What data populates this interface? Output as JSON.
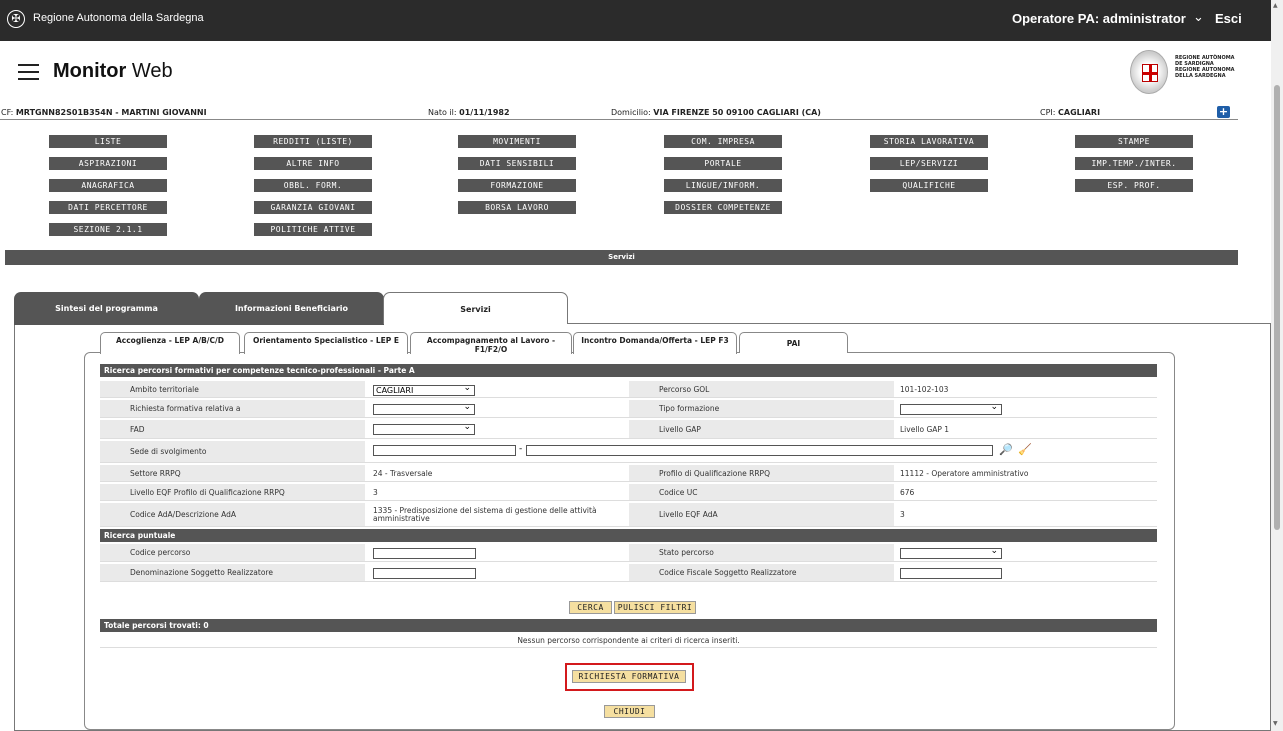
{
  "topbar": {
    "org": "Regione Autonoma della Sardegna",
    "operator": "Operatore PA: administrator",
    "logout": "Esci"
  },
  "header": {
    "brand_bold": "Monitor",
    "brand_light": " Web",
    "crest_lines": [
      "REGIONE AUTÒNOMA",
      "DE SARDIGNA",
      "REGIONE AUTONOMA",
      "DELLA SARDEGNA"
    ]
  },
  "infobar": {
    "cf_label": "CF: ",
    "cf_value": "MRTGNN82S01B354N - MARTINI GIOVANNI",
    "nato_label": "Nato il: ",
    "nato_value": "01/11/1982",
    "dom_label": "Domicilio: ",
    "dom_value": "VIA FIRENZE 50 09100 CAGLIARI (CA)",
    "cpi_label": "CPI: ",
    "cpi_value": "CAGLIARI",
    "plus": "+"
  },
  "nav": [
    [
      "LISTE",
      "REDDITI (LISTE)",
      "MOVIMENTI",
      "COM. IMPRESA",
      "STORIA LAVORATIVA",
      "STAMPE"
    ],
    [
      "ASPIRAZIONI",
      "ALTRE INFO",
      "DATI SENSIBILI",
      "PORTALE",
      "LEP/SERVIZI",
      "IMP.TEMP./INTER."
    ],
    [
      "ANAGRAFICA",
      "OBBL. FORM.",
      "FORMAZIONE",
      "LINGUE/INFORM.",
      "QUALIFICHE",
      "ESP. PROF."
    ],
    [
      "DATI PERCETTORE",
      "GARANZIA GIOVANI",
      "BORSA LAVORO",
      "DOSSIER COMPETENZE"
    ],
    [
      "SEZIONE 2.1.1",
      "POLITICHE ATTIVE"
    ]
  ],
  "servizi_bar": "Servizi",
  "main_tabs": [
    "Sintesi del programma",
    "Informazioni Beneficiario",
    "Servizi"
  ],
  "sub_tabs": [
    "Accoglienza - LEP A/B/C/D",
    "Orientamento Specialistico - LEP E",
    "Accompagnamento al Lavoro - F1/F2/O",
    "Incontro Domanda/Offerta - LEP F3",
    "PAI"
  ],
  "section_a": "Ricerca percorsi formativi per competenze tecnico-professionali - Parte A",
  "fields": {
    "ambito_label": "Ambito territoriale",
    "ambito_value": "CAGLIARI",
    "percorso_gol_label": "Percorso GOL",
    "percorso_gol_value": "101-102-103",
    "richiesta_label": "Richiesta formativa relativa a",
    "tipo_form_label": "Tipo formazione",
    "fad_label": "FAD",
    "livello_gap_label": "Livello GAP",
    "livello_gap_value": "Livello GAP 1",
    "sede_label": "Sede di svolgimento",
    "sede_sep": "-",
    "settore_label": "Settore RRPQ",
    "settore_value": "24 - Trasversale",
    "profilo_label": "Profilo di Qualificazione RRPQ",
    "profilo_value": "11112 - Operatore amministrativo",
    "eqf_label": "Livello EQF Profilo di Qualificazione RRPQ",
    "eqf_value": "3",
    "uc_label": "Codice UC",
    "uc_value": "676",
    "ada_label": "Codice AdA/Descrizione AdA",
    "ada_value": "1335 - Predisposizione del sistema di gestione delle attività amministrative",
    "eqf_ada_label": "Livello EQF AdA",
    "eqf_ada_value": "3"
  },
  "section_b": "Ricerca puntuale",
  "puntuale": {
    "codice_label": "Codice percorso",
    "stato_label": "Stato percorso",
    "denominazione_label": "Denominazione Soggetto Realizzatore",
    "cf_sogg_label": "Codice Fiscale Soggetto Realizzatore"
  },
  "buttons": {
    "cerca": "CERCA",
    "pulisci": "PULISCI FILTRI",
    "richiesta": "RICHIESTA FORMATIVA",
    "chiudi": "CHIUDI"
  },
  "totale": "Totale percorsi trovati: 0",
  "nessun": "Nessun percorso corrispondente ai criteri di ricerca inseriti.",
  "colors": {
    "dark_bar": "#555555",
    "topbar": "#2b2b2b",
    "button": "#f5dfa0",
    "highlight": "#d3191c",
    "plus": "#1f5ea8"
  },
  "icons": [
    "sardinia-logo-icon",
    "chevron-down-icon",
    "hamburger-icon",
    "crest-icon",
    "plus-icon",
    "search-binoculars-icon",
    "broom-clear-icon"
  ]
}
